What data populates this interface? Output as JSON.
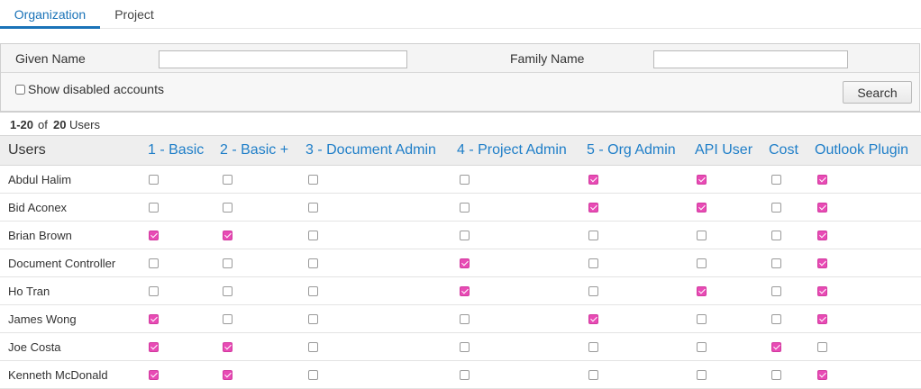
{
  "tabs": [
    {
      "label": "Organization",
      "active": true
    },
    {
      "label": "Project",
      "active": false
    }
  ],
  "filters": {
    "given_name_label": "Given Name",
    "given_name_value": "",
    "family_name_label": "Family Name",
    "family_name_value": "",
    "show_disabled_label": "Show disabled accounts",
    "show_disabled_checked": false,
    "search_button": "Search"
  },
  "count": {
    "range": "1-20",
    "of": "of",
    "total": "20",
    "suffix": "Users"
  },
  "colors": {
    "accent": "#1e7ec8",
    "checked": "#e84bb5"
  },
  "table": {
    "users_header": "Users",
    "columns": [
      "1 - Basic",
      "2 - Basic +",
      "3 - Document Admin",
      "4 - Project Admin",
      "5 - Org Admin",
      "API User",
      "Cost",
      "Outlook Plugin"
    ],
    "rows": [
      {
        "name": "Abdul Halim",
        "roles": [
          false,
          false,
          false,
          false,
          true,
          true,
          false,
          true
        ]
      },
      {
        "name": "Bid Aconex",
        "roles": [
          false,
          false,
          false,
          false,
          true,
          true,
          false,
          true
        ]
      },
      {
        "name": "Brian Brown",
        "roles": [
          true,
          true,
          false,
          false,
          false,
          false,
          false,
          true
        ]
      },
      {
        "name": "Document Controller",
        "roles": [
          false,
          false,
          false,
          true,
          false,
          false,
          false,
          true
        ]
      },
      {
        "name": "Ho Tran",
        "roles": [
          false,
          false,
          false,
          true,
          false,
          true,
          false,
          true
        ]
      },
      {
        "name": "James Wong",
        "roles": [
          true,
          false,
          false,
          false,
          true,
          false,
          false,
          true
        ]
      },
      {
        "name": "Joe Costa",
        "roles": [
          true,
          true,
          false,
          false,
          false,
          false,
          true,
          false
        ]
      },
      {
        "name": "Kenneth McDonald",
        "roles": [
          true,
          true,
          false,
          false,
          false,
          false,
          false,
          true
        ]
      }
    ]
  }
}
